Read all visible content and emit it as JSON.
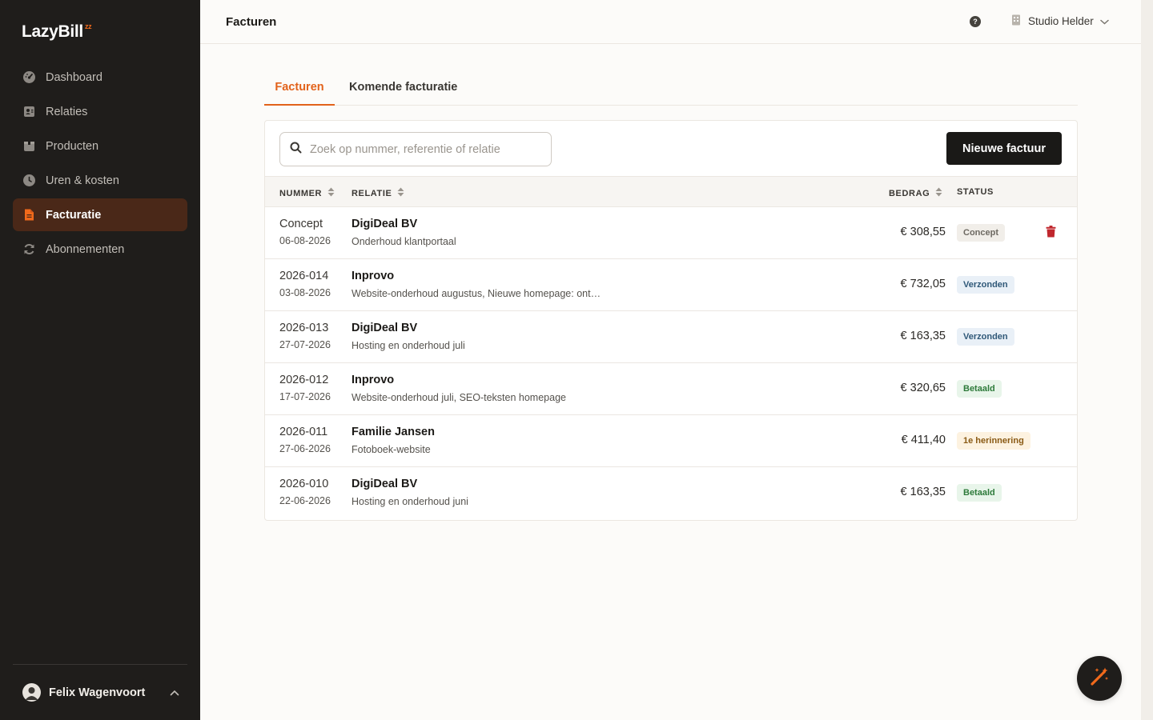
{
  "brand": {
    "name": "LazyBill",
    "mark": "zz",
    "accent": "#f26a1b"
  },
  "sidebar": {
    "items": [
      {
        "label": "Dashboard",
        "icon": "gauge-icon"
      },
      {
        "label": "Relaties",
        "icon": "contacts-icon"
      },
      {
        "label": "Producten",
        "icon": "box-icon"
      },
      {
        "label": "Uren & kosten",
        "icon": "clock-icon"
      },
      {
        "label": "Facturatie",
        "icon": "invoice-icon",
        "active": true
      },
      {
        "label": "Abonnementen",
        "icon": "refresh-icon"
      }
    ],
    "user": {
      "name": "Felix Wagenvoort"
    }
  },
  "header": {
    "title": "Facturen",
    "help_glyph": "?",
    "organization": "Studio Helder"
  },
  "tabs": [
    {
      "label": "Facturen",
      "active": true
    },
    {
      "label": "Komende facturatie",
      "active": false
    }
  ],
  "search": {
    "placeholder": "Zoek op nummer, referentie of relatie",
    "value": ""
  },
  "new_invoice_label": "Nieuwe factuur",
  "table": {
    "columns": [
      "NUMMER",
      "RELATIE",
      "BEDRAG",
      "STATUS"
    ],
    "rows": [
      {
        "number": "Concept",
        "date": "06-08-2026",
        "client": "DigiDeal BV",
        "description": "Onderhoud klantportaal",
        "amount": "€ 308,55",
        "status": "Concept",
        "deletable": true
      },
      {
        "number": "2026-014",
        "date": "03-08-2026",
        "client": "Inprovo",
        "description": "Website-onderhoud augustus, Nieuwe homepage: ont…",
        "amount": "€ 732,05",
        "status": "Verzonden"
      },
      {
        "number": "2026-013",
        "date": "27-07-2026",
        "client": "DigiDeal BV",
        "description": "Hosting en onderhoud juli",
        "amount": "€ 163,35",
        "status": "Verzonden"
      },
      {
        "number": "2026-012",
        "date": "17-07-2026",
        "client": "Inprovo",
        "description": "Website-onderhoud juli, SEO-teksten homepage",
        "amount": "€ 320,65",
        "status": "Betaald"
      },
      {
        "number": "2026-011",
        "date": "27-06-2026",
        "client": "Familie Jansen",
        "description": "Fotoboek-website",
        "amount": "€ 411,40",
        "status": "1e herinnering"
      },
      {
        "number": "2026-010",
        "date": "22-06-2026",
        "client": "DigiDeal BV",
        "description": "Hosting en onderhoud juni",
        "amount": "€ 163,35",
        "status": "Betaald"
      }
    ]
  },
  "colors": {
    "accent": "#e2621b",
    "sidebar_bg": "#1f1d1b",
    "active_nav_bg": "#4a2818",
    "danger": "#c0272d"
  }
}
